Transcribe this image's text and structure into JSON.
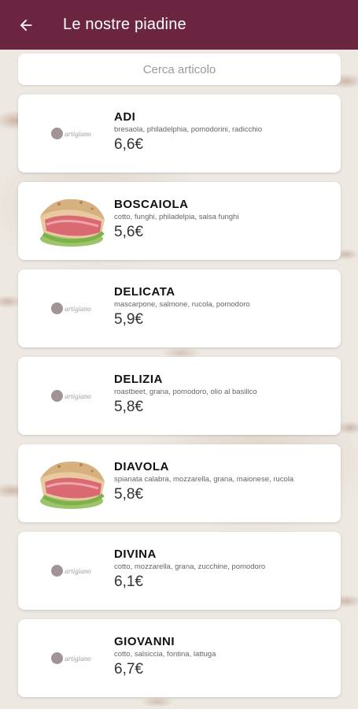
{
  "appbar": {
    "title": "Le nostre piadine",
    "back_icon": "arrow-back-icon",
    "background": "#6b2540"
  },
  "search": {
    "placeholder": "Cerca articolo"
  },
  "logo_text": "artigiano",
  "items": [
    {
      "name": "ADI",
      "ingredients": "bresaola, philadelphia, pomodorini, radicchio",
      "price": "6,6€",
      "image": "logo"
    },
    {
      "name": "BOSCAIOLA",
      "ingredients": "cotto, funghi, philadelpia, salsa funghi",
      "price": "5,6€",
      "image": "piadina"
    },
    {
      "name": "DELICATA",
      "ingredients": "mascarpone, salmone, rucola, pomodoro",
      "price": "5,9€",
      "image": "logo"
    },
    {
      "name": "DELIZIA",
      "ingredients": "roastbeet, grana, pomodoro, olio al basilico",
      "price": "5,8€",
      "image": "logo"
    },
    {
      "name": "DIAVOLA",
      "ingredients": "spianata calabra, mozzarella, grana, maionese, rucola",
      "price": "5,8€",
      "image": "piadina"
    },
    {
      "name": "DIVINA",
      "ingredients": "cotto, mozzarella, grana, zucchine, pomodoro",
      "price": "6,1€",
      "image": "logo"
    },
    {
      "name": "GIOVANNI",
      "ingredients": "cotto, salsiccia, fontina, lattuga",
      "price": "6,7€",
      "image": "logo"
    }
  ]
}
